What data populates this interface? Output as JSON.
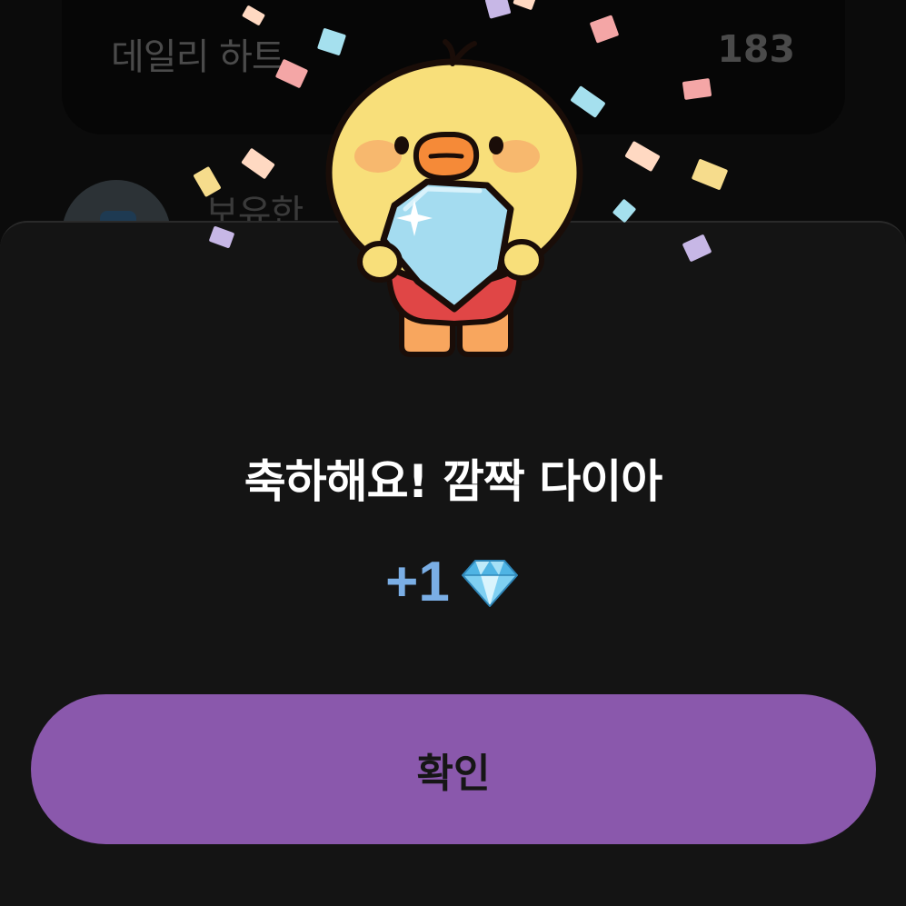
{
  "background": {
    "card_label": "데일리 하트",
    "card_value": "183",
    "row_label": "보유한"
  },
  "dialog": {
    "title": "축하해요! 깜짝 다이아",
    "reward_amount": "+1",
    "reward_icon": "diamond-icon",
    "confirm_label": "확인"
  },
  "colors": {
    "sheet_background": "#141414",
    "button_background": "#8a58ac",
    "reward_text": "#7aaee5",
    "confetti": [
      "#a5e0ee",
      "#f4a6a6",
      "#c7b7e6",
      "#f6dc8c",
      "#ffd9c2"
    ]
  }
}
